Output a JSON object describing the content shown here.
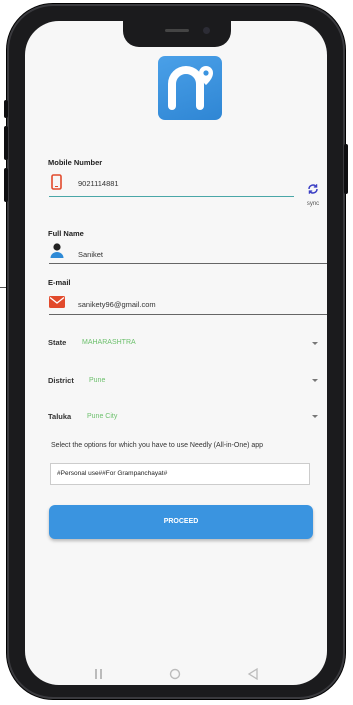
{
  "form": {
    "mobile_label": "Mobile Number",
    "mobile_value": "9021114881",
    "sync_label": "sync",
    "fullname_label": "Full Name",
    "fullname_value": "Saniket",
    "email_label": "E-mail",
    "email_value": "sanikety96@gmail.com",
    "state_label": "State",
    "state_value": "MAHARASHTRA",
    "district_label": "District",
    "district_value": "Pune",
    "taluka_label": "Taluka",
    "taluka_value": "Pune City",
    "help_text": "Select the options for which you have to use Needly (All-in-One) app",
    "options_value": "#Personal use##For Grampanchayat#",
    "proceed_label": "PROCEED"
  },
  "colors": {
    "accent": "#3a94e0",
    "value_green": "#6cc06c",
    "mobile_icon": "#e24a2c",
    "email_icon": "#e24a2c"
  },
  "icons": [
    "logo-icon",
    "phone-icon",
    "sync-icon",
    "person-icon",
    "email-icon",
    "chevron-down-icon",
    "recents-icon",
    "home-icon",
    "back-icon"
  ]
}
